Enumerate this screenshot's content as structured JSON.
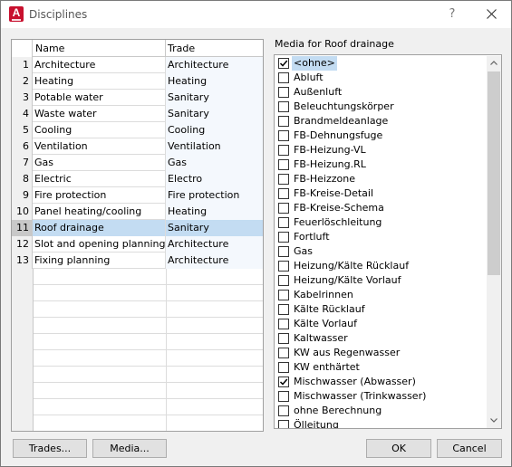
{
  "window": {
    "title": "Disciplines",
    "icon_letter": "A",
    "help_label": "?"
  },
  "grid": {
    "columns": {
      "name": "Name",
      "trade": "Trade"
    },
    "rows": [
      {
        "idx": "1",
        "name": "Architecture",
        "trade": "Architecture"
      },
      {
        "idx": "2",
        "name": "Heating",
        "trade": "Heating"
      },
      {
        "idx": "3",
        "name": "Potable water",
        "trade": "Sanitary"
      },
      {
        "idx": "4",
        "name": "Waste water",
        "trade": "Sanitary"
      },
      {
        "idx": "5",
        "name": "Cooling",
        "trade": "Cooling"
      },
      {
        "idx": "6",
        "name": "Ventilation",
        "trade": "Ventilation"
      },
      {
        "idx": "7",
        "name": "Gas",
        "trade": "Gas"
      },
      {
        "idx": "8",
        "name": "Electric",
        "trade": "Electro"
      },
      {
        "idx": "9",
        "name": "Fire protection",
        "trade": "Fire protection"
      },
      {
        "idx": "10",
        "name": "Panel heating/cooling",
        "trade": "Heating"
      },
      {
        "idx": "11",
        "name": "Roof drainage",
        "trade": "Sanitary"
      },
      {
        "idx": "12",
        "name": "Slot and opening planning",
        "trade": "Architecture"
      },
      {
        "idx": "13",
        "name": "Fixing planning",
        "trade": "Architecture"
      }
    ],
    "selected_index": 10
  },
  "media": {
    "label": "Media for Roof drainage",
    "items": [
      {
        "label": "<ohne>",
        "checked": true,
        "focused": true
      },
      {
        "label": "Abluft",
        "checked": false
      },
      {
        "label": "Außenluft",
        "checked": false
      },
      {
        "label": "Beleuchtungskörper",
        "checked": false
      },
      {
        "label": "Brandmeldeanlage",
        "checked": false
      },
      {
        "label": "FB-Dehnungsfuge",
        "checked": false
      },
      {
        "label": "FB-Heizung-VL",
        "checked": false
      },
      {
        "label": "FB-Heizung.RL",
        "checked": false
      },
      {
        "label": "FB-Heizzone",
        "checked": false
      },
      {
        "label": "FB-Kreise-Detail",
        "checked": false
      },
      {
        "label": "FB-Kreise-Schema",
        "checked": false
      },
      {
        "label": "Feuerlöschleitung",
        "checked": false
      },
      {
        "label": "Fortluft",
        "checked": false
      },
      {
        "label": "Gas",
        "checked": false
      },
      {
        "label": "Heizung/Kälte Rücklauf",
        "checked": false
      },
      {
        "label": "Heizung/Kälte Vorlauf",
        "checked": false
      },
      {
        "label": "Kabelrinnen",
        "checked": false
      },
      {
        "label": "Kälte Rücklauf",
        "checked": false
      },
      {
        "label": "Kälte Vorlauf",
        "checked": false
      },
      {
        "label": "Kaltwasser",
        "checked": false
      },
      {
        "label": "KW aus Regenwasser",
        "checked": false
      },
      {
        "label": "KW enthärtet",
        "checked": false
      },
      {
        "label": "Mischwasser (Abwasser)",
        "checked": true
      },
      {
        "label": "Mischwasser (Trinkwasser)",
        "checked": false
      },
      {
        "label": "ohne Berechnung",
        "checked": false
      },
      {
        "label": "Ölleitung",
        "checked": false
      }
    ]
  },
  "buttons": {
    "trades": "Trades...",
    "media": "Media...",
    "ok": "OK",
    "cancel": "Cancel"
  },
  "colors": {
    "selection": "#c3dcf2",
    "accent_icon": "#c8102e"
  }
}
